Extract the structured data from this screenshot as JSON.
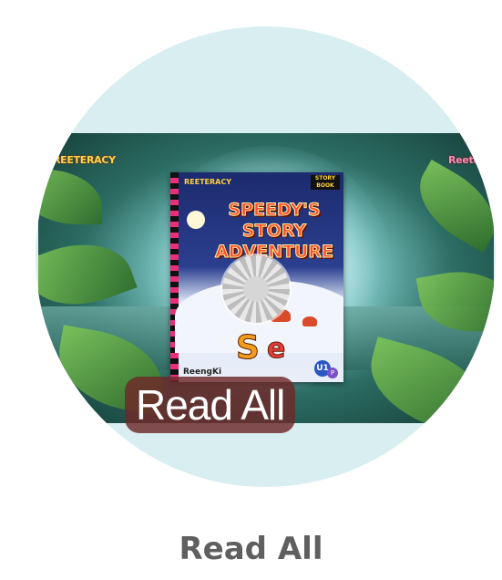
{
  "card": {
    "label": "Read All",
    "overlay_label": "Read All",
    "state": "loading"
  },
  "scene": {
    "logo_left": "REETERACY",
    "logo_right": "Reete"
  },
  "book": {
    "publisher_logo": "REETERACY",
    "series_tag": "STORY BOOK",
    "title": "SPEEDY'S\nSTORY\nADVENTURE",
    "author": "ReengKi",
    "level": "U1",
    "level_sub": "P"
  },
  "colors": {
    "circle_bg": "#d9eef0",
    "label_bg": "#6e2828",
    "caption_text": "#5f5f5f"
  },
  "icons": {
    "loading": "loading-spinner-icon"
  }
}
